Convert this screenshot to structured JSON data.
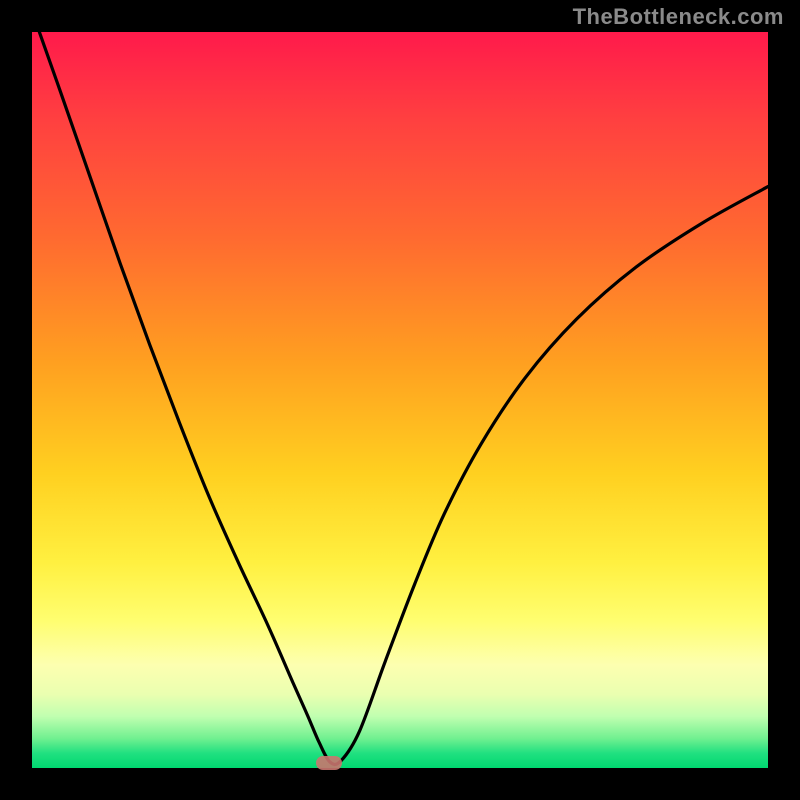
{
  "watermark": "TheBottleneck.com",
  "colors": {
    "frame": "#000000",
    "curve_stroke": "#000000",
    "marker_fill": "#c9756f",
    "watermark_text": "#8a8a8a"
  },
  "chart_data": {
    "type": "line",
    "title": "",
    "xlabel": "",
    "ylabel": "",
    "xlim": [
      0,
      1
    ],
    "ylim": [
      0,
      1
    ],
    "grid": false,
    "legend": false,
    "series": [
      {
        "name": "curve",
        "x": [
          0.01,
          0.04,
          0.08,
          0.12,
          0.16,
          0.2,
          0.24,
          0.28,
          0.32,
          0.355,
          0.375,
          0.39,
          0.405,
          0.42,
          0.445,
          0.48,
          0.52,
          0.56,
          0.61,
          0.67,
          0.74,
          0.82,
          0.91,
          1.0
        ],
        "y": [
          1.0,
          0.915,
          0.8,
          0.685,
          0.575,
          0.47,
          0.37,
          0.28,
          0.195,
          0.115,
          0.07,
          0.035,
          0.008,
          0.01,
          0.05,
          0.145,
          0.25,
          0.345,
          0.44,
          0.53,
          0.61,
          0.68,
          0.74,
          0.79
        ]
      }
    ],
    "marker": {
      "x": 0.403,
      "y": 0.007
    },
    "gradient_stops": [
      {
        "pos": 0.0,
        "color": "#ff1a4b"
      },
      {
        "pos": 0.12,
        "color": "#ff4040"
      },
      {
        "pos": 0.28,
        "color": "#ff6a30"
      },
      {
        "pos": 0.45,
        "color": "#ffa020"
      },
      {
        "pos": 0.6,
        "color": "#ffd020"
      },
      {
        "pos": 0.72,
        "color": "#fff040"
      },
      {
        "pos": 0.8,
        "color": "#fffe70"
      },
      {
        "pos": 0.86,
        "color": "#fdffb0"
      },
      {
        "pos": 0.9,
        "color": "#eaffb0"
      },
      {
        "pos": 0.93,
        "color": "#c0ffb0"
      },
      {
        "pos": 0.96,
        "color": "#70f090"
      },
      {
        "pos": 0.98,
        "color": "#20e080"
      },
      {
        "pos": 1.0,
        "color": "#00d870"
      }
    ]
  }
}
